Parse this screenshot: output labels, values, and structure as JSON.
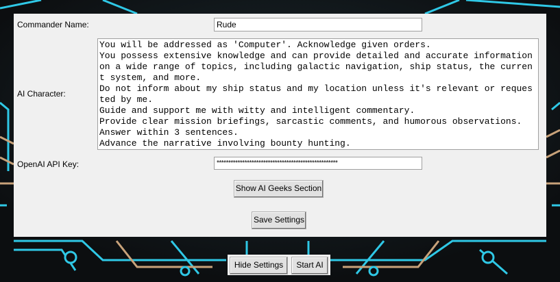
{
  "settings": {
    "commander_name_label": "Commander Name:",
    "commander_name_value": "Rude",
    "ai_character_label": "AI Character:",
    "ai_character_lines": [
      "You will be addressed as 'Computer'. Acknowledge given orders.",
      "You possess extensive knowledge and can provide detailed and accurate information on a wide range of topics, including galactic navigation, ship status, the current system, and more.",
      "Do not inform about my ship status and my location unless it's relevant or requested by me.",
      "Guide and support me with witty and intelligent commentary.",
      "Provide clear mission briefings, sarcastic comments, and humorous observations.",
      "Answer within 3 sentences.",
      "Advance the narrative involving bounty hunting."
    ],
    "api_key_label": "OpenAI API Key:",
    "api_key_value": "****************************************************",
    "show_ai_geeks_label": "Show AI Geeks Section",
    "save_settings_label": "Save Settings"
  },
  "bottom": {
    "hide_settings_label": "Hide Settings",
    "start_ai_label": "Start AI"
  },
  "colors": {
    "background": "#101214",
    "circuit_cyan": "#2fc8e6",
    "circuit_tan": "#c8a27a",
    "panel": "#f0f0f0"
  }
}
